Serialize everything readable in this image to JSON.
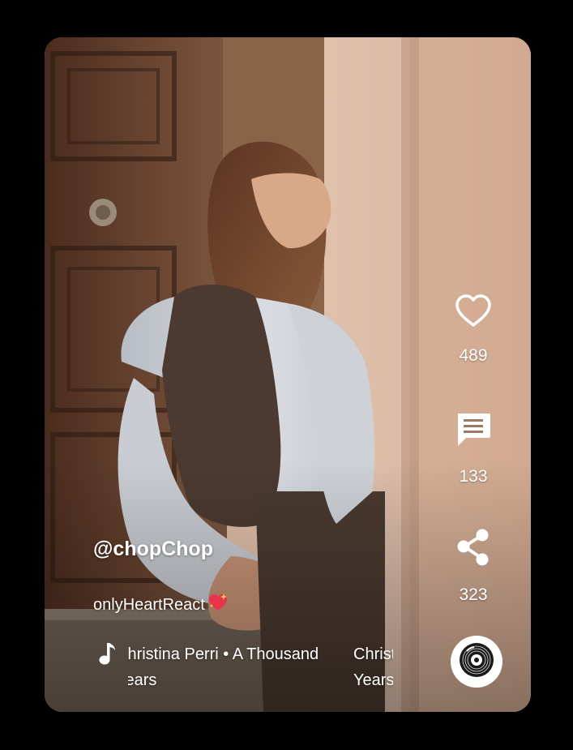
{
  "post": {
    "username": "@chopChop",
    "caption": "onlyHeartReact",
    "caption_emoji": "sparkling-heart-icon",
    "song": "Christina Perri • A Thousand Years"
  },
  "actions": {
    "likes": "489",
    "comments": "133",
    "shares": "323"
  },
  "icons": {
    "like": "heart-outline-icon",
    "comment": "comment-icon",
    "share": "share-icon",
    "music": "music-note-icon",
    "disc": "vinyl-disc-icon"
  },
  "colors": {
    "page_background": "#000000",
    "text": "#ffffff",
    "emoji_heart": "#e8344a",
    "emoji_sparkle": "#ffd34a"
  }
}
